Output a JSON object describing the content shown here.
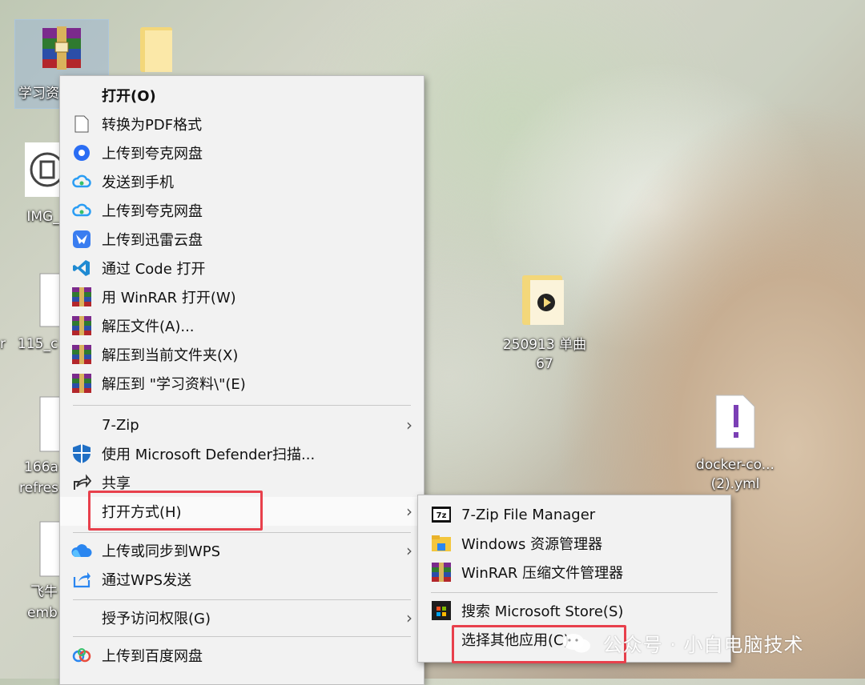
{
  "desktop": {
    "icons": [
      {
        "label": "学习资"
      },
      {
        "label": "IMG_"
      },
      {
        "label": "115_c"
      },
      {
        "label": "166a"
      },
      {
        "label": "refres"
      },
      {
        "label": "飞牛"
      },
      {
        "label": "emb"
      },
      {
        "label": "250913 单曲"
      },
      {
        "label": "67"
      },
      {
        "label": "docker-co..."
      },
      {
        "label": "(2).yml"
      },
      {
        "label": "r"
      }
    ]
  },
  "context_menu": {
    "items": [
      {
        "label": "打开(O)"
      },
      {
        "label": "转换为PDF格式"
      },
      {
        "label": "上传到夸克网盘"
      },
      {
        "label": "发送到手机"
      },
      {
        "label": "上传到夸克网盘"
      },
      {
        "label": "上传到迅雷云盘"
      },
      {
        "label": "通过 Code 打开"
      },
      {
        "label": "用 WinRAR 打开(W)"
      },
      {
        "label": "解压文件(A)..."
      },
      {
        "label": "解压到当前文件夹(X)"
      },
      {
        "label": "解压到 \"学习资料\\\"(E)"
      },
      {
        "label": "7-Zip"
      },
      {
        "label": "使用 Microsoft Defender扫描..."
      },
      {
        "label": "共享"
      },
      {
        "label": "打开方式(H)"
      },
      {
        "label": "上传或同步到WPS"
      },
      {
        "label": "通过WPS发送"
      },
      {
        "label": "授予访问权限(G)"
      },
      {
        "label": "上传到百度网盘"
      }
    ]
  },
  "submenu": {
    "items": [
      {
        "label": "7-Zip File Manager"
      },
      {
        "label": "Windows 资源管理器"
      },
      {
        "label": "WinRAR 压缩文件管理器"
      },
      {
        "label": "搜索 Microsoft Store(S)"
      },
      {
        "label": "选择其他应用(C)"
      }
    ]
  },
  "watermark": {
    "text": "公众号 · 小白电脑技术"
  },
  "colors": {
    "highlight_box": "#e8404c",
    "menu_bg": "#f2f2f2"
  }
}
